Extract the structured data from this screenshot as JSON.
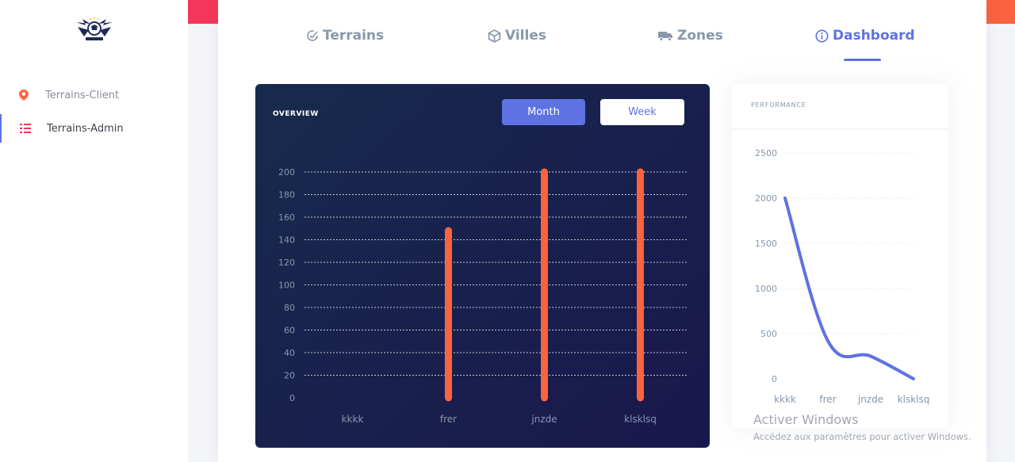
{
  "sidebar": {
    "items": [
      {
        "label": "Terrains-Client",
        "icon": "location-pin-icon"
      },
      {
        "label": "Terrains-Admin",
        "icon": "list-icon"
      }
    ]
  },
  "tabs": [
    {
      "label": "Terrains",
      "icon": "check-badge-icon"
    },
    {
      "label": "Villes",
      "icon": "cube-icon"
    },
    {
      "label": "Zones",
      "icon": "truck-icon"
    },
    {
      "label": "Dashboard",
      "icon": "info-icon",
      "active": true
    }
  ],
  "overview": {
    "title": "OVERVIEW",
    "month_label": "Month",
    "week_label": "Week"
  },
  "performance": {
    "title": "PERFORMANCE"
  },
  "watermark": {
    "line1": "Activer Windows",
    "line2": "Accédez aux paramètres pour activer Windows."
  },
  "colors": {
    "accent": "#5e72e4",
    "bar": "#fb6340",
    "strip_start": "#f5365c",
    "strip_end": "#fb6340",
    "overview_bg": "#172b4d"
  },
  "chart_data": [
    {
      "type": "bar",
      "categories": [
        "kkkk",
        "frer",
        "jnzde",
        "klsklsq"
      ],
      "values": [
        0,
        148,
        200,
        200
      ],
      "ylim": [
        0,
        200
      ],
      "yticks": [
        0,
        20,
        40,
        60,
        80,
        100,
        120,
        140,
        160,
        180,
        200
      ],
      "grid": true
    },
    {
      "type": "line",
      "categories": [
        "kkkk",
        "frer",
        "jnzde",
        "klsklsq"
      ],
      "values": [
        2000,
        420,
        250,
        0
      ],
      "ylim": [
        0,
        2500
      ],
      "yticks": [
        0,
        500,
        1000,
        1500,
        2000,
        2500
      ],
      "grid": true
    }
  ]
}
